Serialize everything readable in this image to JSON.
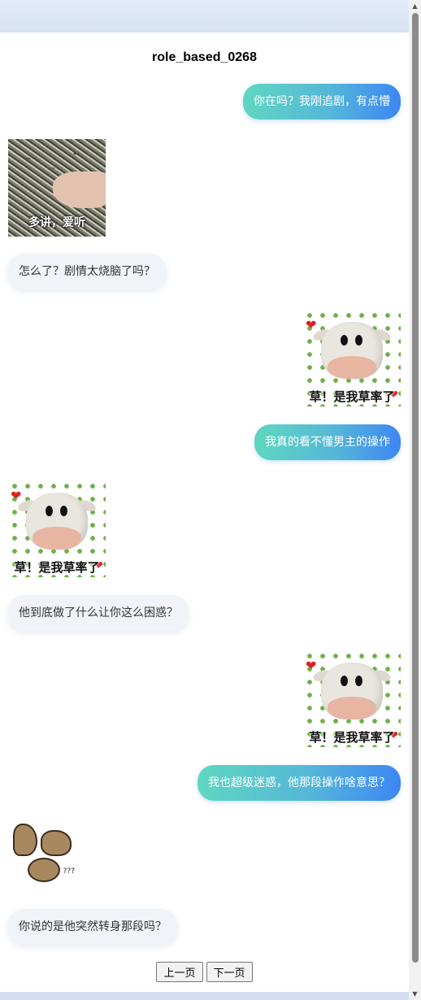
{
  "title": "role_based_0268",
  "messages": [
    {
      "role": "user",
      "type": "text",
      "text": "你在吗？我刚追剧，有点懵"
    },
    {
      "role": "bot",
      "type": "sticker",
      "sticker": "sunflower-seeds-sticker",
      "caption": "多讲，爱听"
    },
    {
      "role": "bot",
      "type": "text",
      "text": "怎么了？剧情太烧脑了吗？"
    },
    {
      "role": "user",
      "type": "sticker",
      "sticker": "crying-cow-sticker",
      "caption": "草！是我草率了"
    },
    {
      "role": "user",
      "type": "text",
      "text": "我真的看不懂男主的操作"
    },
    {
      "role": "bot",
      "type": "sticker",
      "sticker": "crying-cow-sticker",
      "caption": "草！是我草率了"
    },
    {
      "role": "bot",
      "type": "text",
      "text": "他到底做了什么让你这么困惑？"
    },
    {
      "role": "user",
      "type": "sticker",
      "sticker": "crying-cow-sticker",
      "caption": "草！是我草率了"
    },
    {
      "role": "user",
      "type": "text",
      "text": "我也超级迷惑，他那段操作啥意思？"
    },
    {
      "role": "bot",
      "type": "sticker",
      "sticker": "confused-horse-sticker",
      "caption": "???"
    },
    {
      "role": "bot",
      "type": "text",
      "text": "你说的是他突然转身那段吗？"
    }
  ],
  "pager": {
    "prev": "上一页",
    "next": "下一页"
  },
  "colors": {
    "user_gradient_start": "#5fd7c0",
    "user_gradient_end": "#3d86f4",
    "bot_bubble": "#f0f3f8"
  }
}
